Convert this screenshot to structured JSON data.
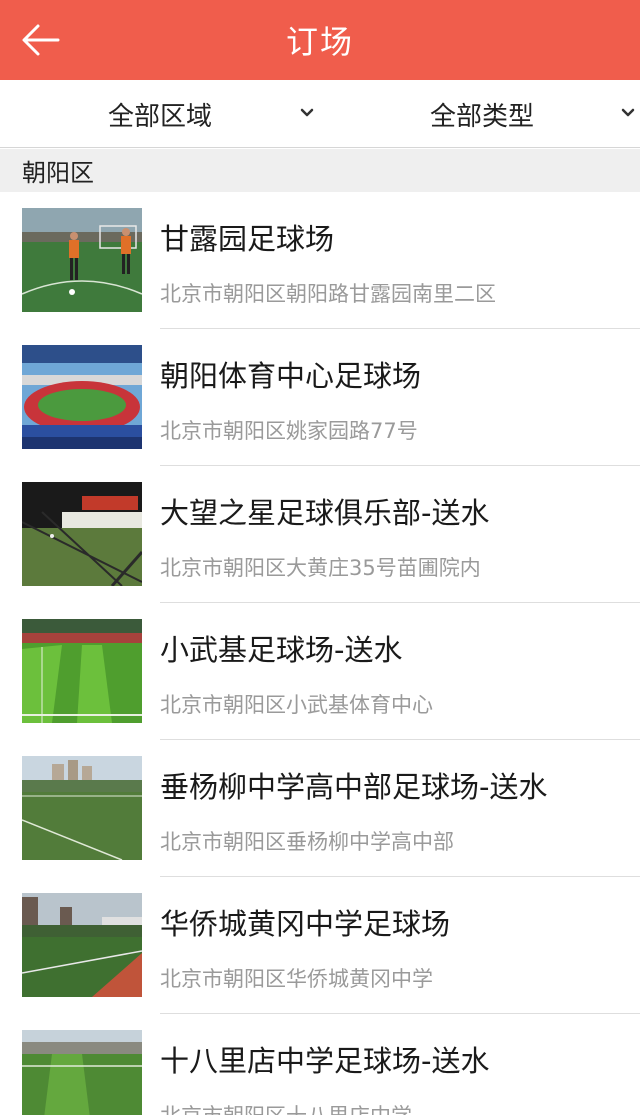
{
  "header": {
    "title": "订场",
    "back_icon": "back-arrow-icon"
  },
  "filters": {
    "area_label": "全部区域",
    "type_label": "全部类型"
  },
  "section": {
    "label": "朝阳区"
  },
  "venues": [
    {
      "name": "甘露园足球场",
      "address": "北京市朝阳区朝阳路甘露园南里二区"
    },
    {
      "name": "朝阳体育中心足球场",
      "address": "北京市朝阳区姚家园路77号"
    },
    {
      "name": "大望之星足球俱乐部-送水",
      "address": "北京市朝阳区大黄庄35号苗圃院内"
    },
    {
      "name": "小武基足球场-送水",
      "address": "北京市朝阳区小武基体育中心"
    },
    {
      "name": "垂杨柳中学高中部足球场-送水",
      "address": "北京市朝阳区垂杨柳中学高中部"
    },
    {
      "name": "华侨城黄冈中学足球场",
      "address": "北京市朝阳区华侨城黄冈中学"
    },
    {
      "name": "十八里店中学足球场-送水",
      "address": "北京市朝阳区十八里店中学"
    }
  ],
  "colors": {
    "header_bg": "#f05d4c",
    "section_bg": "#efefef",
    "address_text": "#9a9a9a"
  }
}
